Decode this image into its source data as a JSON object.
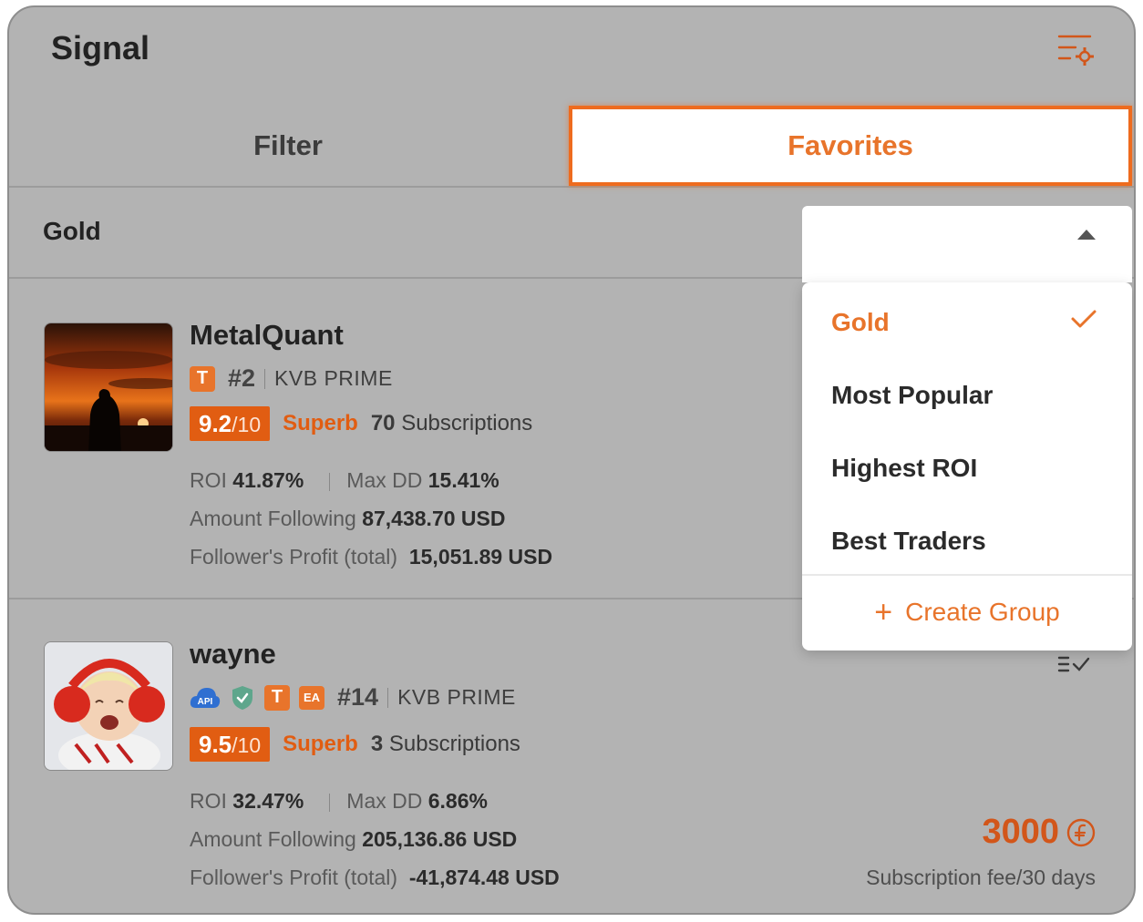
{
  "header": {
    "title": "Signal",
    "settings_icon": "filter-settings-icon"
  },
  "tabs": [
    {
      "label": "Filter",
      "active": false
    },
    {
      "label": "Favorites",
      "active": true
    }
  ],
  "group_bar": {
    "current_group": "Gold"
  },
  "dropdown": {
    "open": true,
    "options": [
      {
        "label": "Gold",
        "selected": true
      },
      {
        "label": "Most Popular",
        "selected": false
      },
      {
        "label": "Highest ROI",
        "selected": false
      },
      {
        "label": "Best Traders",
        "selected": false
      }
    ],
    "create_label": "Create Group"
  },
  "traders": [
    {
      "name": "MetalQuant",
      "badges": [
        "T"
      ],
      "rank": "#2",
      "broker": "KVB PRIME",
      "score": "9.2",
      "score_max": "/10",
      "grade": "Superb",
      "subscriptions_count": "70",
      "subscriptions_label": "Subscriptions",
      "roi_label": "ROI",
      "roi": "41.87%",
      "max_dd_label": "Max DD",
      "max_dd": "15.41%",
      "amount_label": "Amount Following",
      "amount": "87,438.70 USD",
      "profit_label": "Follower's Profit (total)",
      "profit": "15,051.89 USD"
    },
    {
      "name": "wayne",
      "badges": [
        "API",
        "shield",
        "T",
        "EA"
      ],
      "rank": "#14",
      "broker": "KVB PRIME",
      "score": "9.5",
      "score_max": "/10",
      "grade": "Superb",
      "subscriptions_count": "3",
      "subscriptions_label": "Subscriptions",
      "roi_label": "ROI",
      "roi": "32.47%",
      "max_dd_label": "Max DD",
      "max_dd": "6.86%",
      "amount_label": "Amount Following",
      "amount": "205,136.86 USD",
      "profit_label": "Follower's Profit (total)",
      "profit": "-41,874.48 USD",
      "fee": "3000",
      "fee_label": "Subscription fee/30 days"
    }
  ],
  "colors": {
    "accent": "#e8742b",
    "score_bg": "#e15d12",
    "overlay": "#b3b3b3"
  }
}
